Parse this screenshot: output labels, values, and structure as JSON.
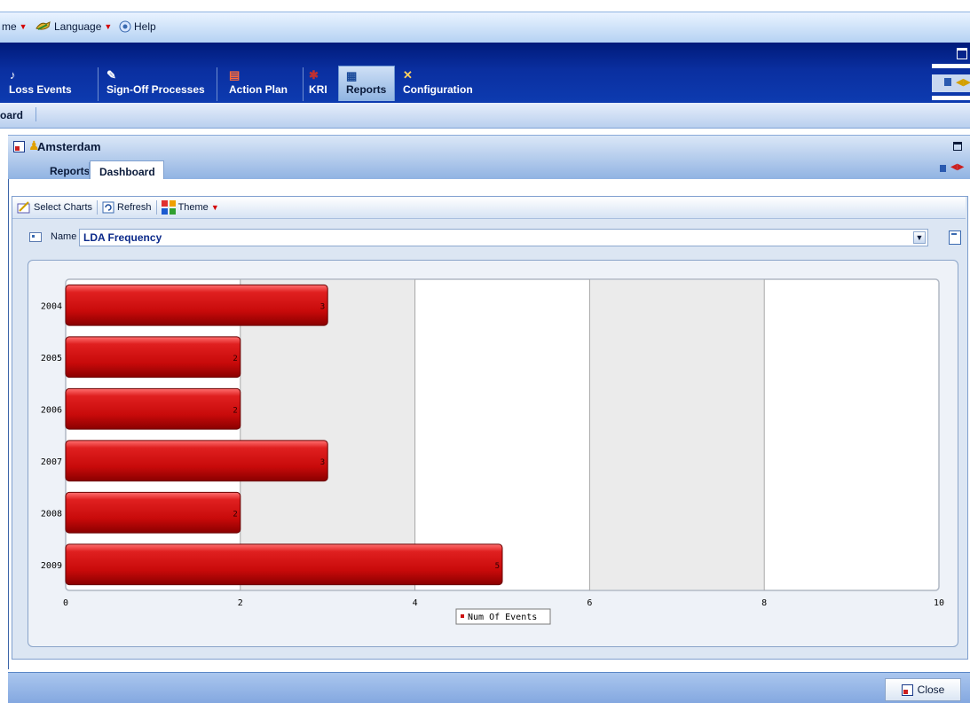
{
  "menu": {
    "theme_label": "me",
    "language_label": "Language",
    "help_label": "Help"
  },
  "modules": [
    {
      "label": "Loss Events"
    },
    {
      "label": "Sign-Off Processes"
    },
    {
      "label": "Action Plan"
    },
    {
      "label": "KRI"
    },
    {
      "label": "Reports"
    },
    {
      "label": "Configuration"
    }
  ],
  "breadcrumb": {
    "label": "oard"
  },
  "panel": {
    "title": "Amsterdam",
    "tabs": [
      {
        "label": "Reports"
      },
      {
        "label": "Dashboard"
      }
    ]
  },
  "toolbar": {
    "select_charts": "Select Charts",
    "refresh": "Refresh",
    "theme": "Theme"
  },
  "name_field": {
    "label": "Name",
    "value": "LDA Frequency"
  },
  "chart_data": {
    "type": "bar",
    "orientation": "horizontal",
    "categories": [
      "2004",
      "2005",
      "2006",
      "2007",
      "2008",
      "2009"
    ],
    "series": [
      {
        "name": "Num Of Events",
        "values": [
          3,
          2,
          2,
          3,
          2,
          5
        ]
      }
    ],
    "x_ticks": [
      "0",
      "2",
      "4",
      "6",
      "8",
      "10"
    ],
    "xlim": [
      0,
      10
    ],
    "legend": "bottom-center",
    "bar_color": "#cc1111"
  },
  "footer": {
    "close_label": "Close"
  },
  "colors": {
    "accent": "#0a2fa0",
    "bar": "#cc1111"
  }
}
